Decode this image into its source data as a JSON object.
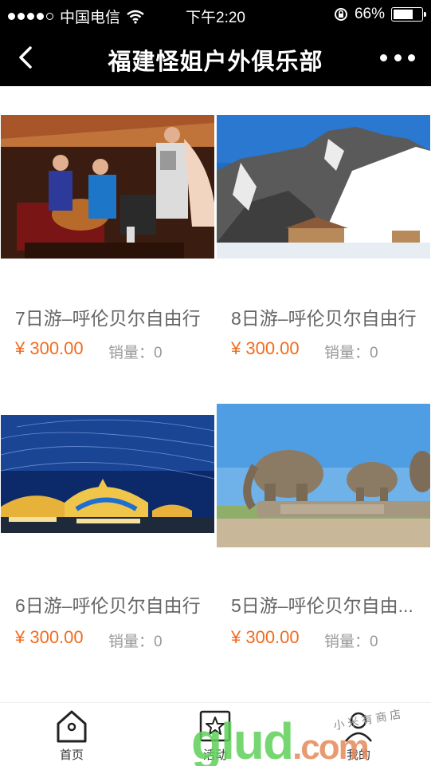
{
  "status": {
    "carrier": "中国电信",
    "time": "下午2:20",
    "battery": "66%",
    "battery_level": 0.66
  },
  "nav": {
    "title": "福建怪姐户外俱乐部"
  },
  "products": [
    {
      "name": "7日游–呼伦贝尔自由行",
      "price": "¥ 300.00",
      "sales": "销量：0",
      "image": "yurt-banquet"
    },
    {
      "name": "8日游–呼伦贝尔自由行",
      "price": "¥ 300.00",
      "sales": "销量：0",
      "image": "snowy-rocks"
    },
    {
      "name": "6日游–呼伦贝尔自由行",
      "price": "¥ 300.00",
      "sales": "销量：0",
      "image": "night-yurts"
    },
    {
      "name": "5日游–呼伦贝尔自由...",
      "price": "¥ 300.00",
      "sales": "销量：0",
      "image": "elephant-statues"
    }
  ],
  "tabs": [
    {
      "label": "首页",
      "icon": "home-icon"
    },
    {
      "label": "活动",
      "icon": "star-icon"
    },
    {
      "label": "我的",
      "icon": "user-icon"
    }
  ],
  "watermark": {
    "main": "glud",
    "suffix": ".com",
    "sub": "小 米 有 商 店"
  },
  "colors": {
    "price": "#f26b1d",
    "header": "#000000"
  }
}
